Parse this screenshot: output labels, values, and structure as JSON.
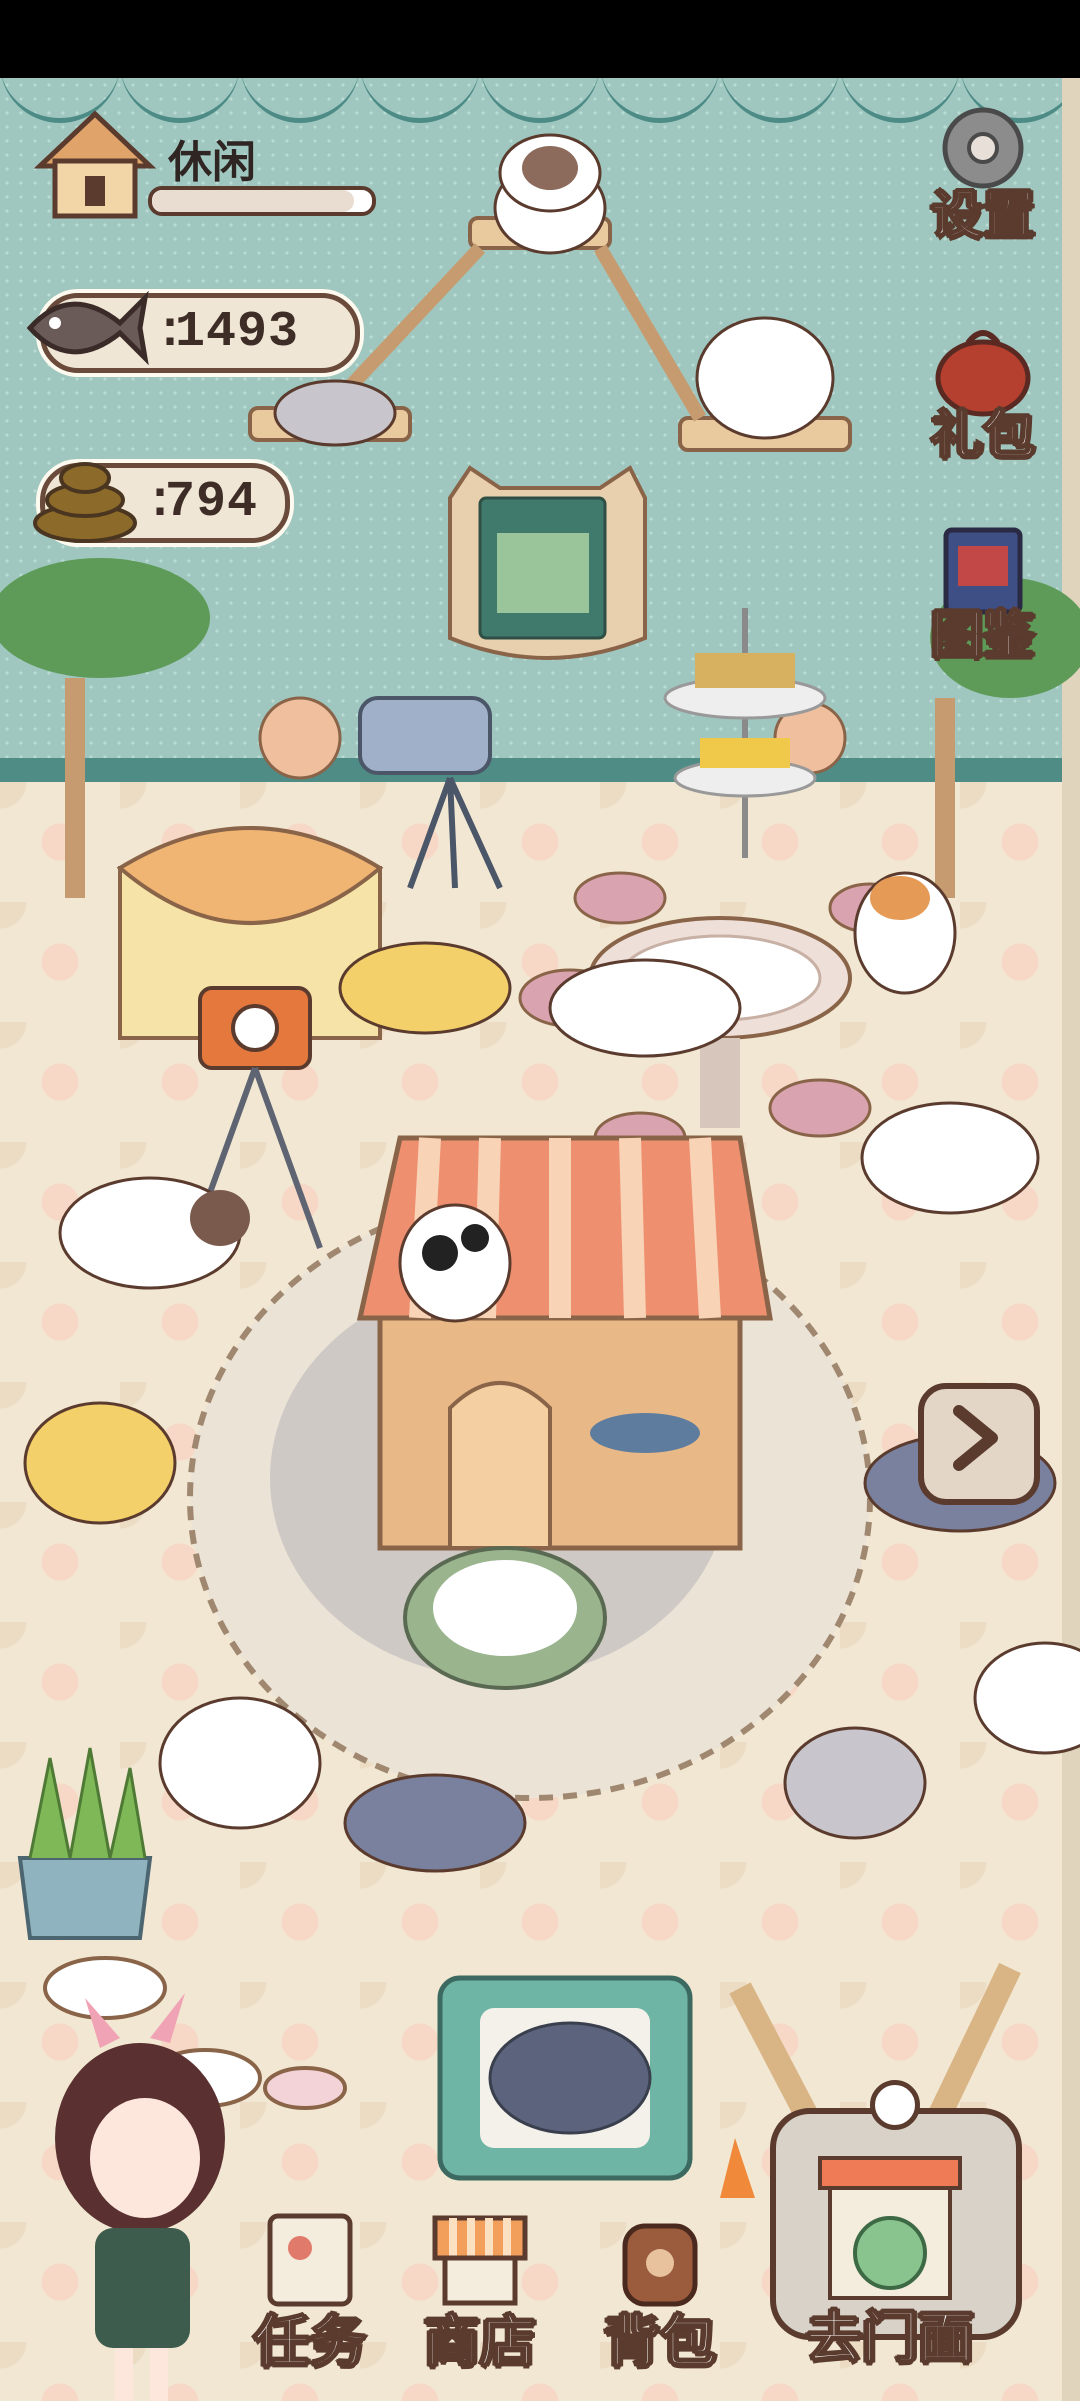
{
  "hud": {
    "status_label": "休闲",
    "status_progress": 0.92,
    "fish_count": "1493",
    "poop_count": "794",
    "currency_prefix": ":"
  },
  "side_buttons": [
    {
      "label": "设置",
      "icon": "gear-icon"
    },
    {
      "label": "礼包",
      "icon": "gift-bag-icon"
    },
    {
      "label": "图鉴",
      "icon": "book-icon"
    }
  ],
  "bottom_buttons": [
    {
      "label": "任务",
      "icon": "task-note-icon"
    },
    {
      "label": "商店",
      "icon": "shop-awning-icon"
    },
    {
      "label": "背包",
      "icon": "backpack-icon"
    }
  ],
  "storefront_button": {
    "label": "去门面",
    "icon": "storefront-icon"
  },
  "colors": {
    "wall": "#9fc7bf",
    "floor": "#f2e7d2",
    "outline": "#5a3b2e",
    "hud_fill": "#efe6d6"
  }
}
